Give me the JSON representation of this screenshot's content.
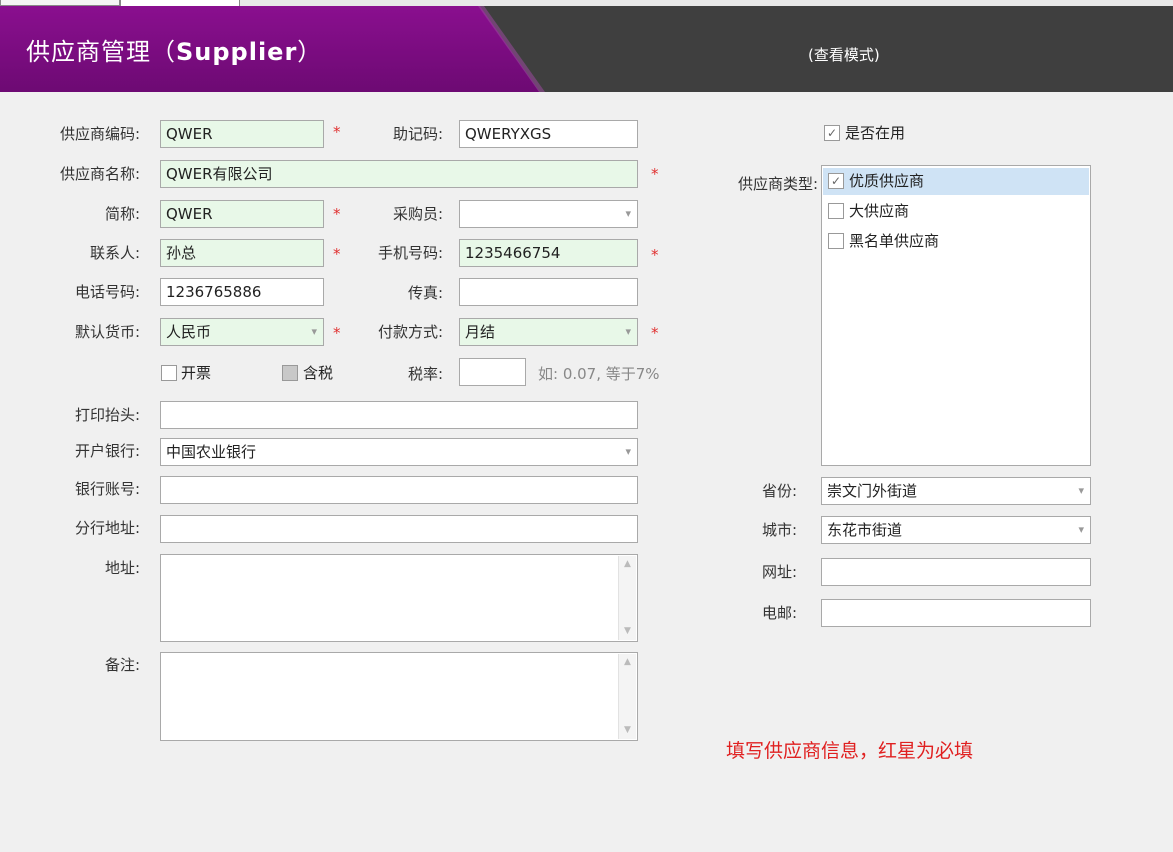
{
  "header": {
    "title_cn": "供应商管理（",
    "title_en": "Supplier",
    "title_close": "）",
    "mode": "(查看模式)"
  },
  "form": {
    "code": {
      "label": "供应商编码:",
      "value": "QWER"
    },
    "mnemonic": {
      "label": "助记码:",
      "value": "QWERYXGS"
    },
    "name": {
      "label": "供应商名称:",
      "value": "QWER有限公司"
    },
    "short": {
      "label": "简称:",
      "value": "QWER"
    },
    "buyer": {
      "label": "采购员:",
      "value": ""
    },
    "contact": {
      "label": "联系人:",
      "value": "孙总"
    },
    "mobile": {
      "label": "手机号码:",
      "value": "1235466754"
    },
    "phone": {
      "label": "电话号码:",
      "value": "1236765886"
    },
    "fax": {
      "label": "传真:",
      "value": ""
    },
    "currency": {
      "label": "默认货币:",
      "value": "人民币"
    },
    "payment": {
      "label": "付款方式:",
      "value": "月结"
    },
    "invoice": {
      "label": "开票",
      "checked": false
    },
    "tax_incl": {
      "label": "含税",
      "checked": false
    },
    "tax_rate": {
      "label": "税率:",
      "value": "",
      "hint": "如: 0.07, 等于7%"
    },
    "print_header": {
      "label": "打印抬头:",
      "value": ""
    },
    "bank": {
      "label": "开户银行:",
      "value": "中国农业银行"
    },
    "account": {
      "label": "银行账号:",
      "value": ""
    },
    "branch": {
      "label": "分行地址:",
      "value": ""
    },
    "address": {
      "label": "地址:",
      "value": ""
    },
    "remark": {
      "label": "备注:",
      "value": ""
    },
    "required_star": "*"
  },
  "right": {
    "in_use": {
      "label": "是否在用",
      "checked": true
    },
    "type_label": "供应商类型:",
    "types": [
      {
        "label": "优质供应商",
        "checked": true
      },
      {
        "label": "大供应商",
        "checked": false
      },
      {
        "label": "黑名单供应商",
        "checked": false
      }
    ],
    "province": {
      "label": "省份:",
      "value": "崇文门外街道"
    },
    "city": {
      "label": "城市:",
      "value": "东花市街道"
    },
    "website": {
      "label": "网址:",
      "value": ""
    },
    "email": {
      "label": "电邮:",
      "value": ""
    }
  },
  "note": "填写供应商信息，红星为必填",
  "colors": {
    "header_purple": "#7a0c80",
    "header_dark": "#3f3f3f",
    "required_bg": "#e8f8e8",
    "star": "#e03030",
    "note": "#e02020"
  },
  "icons": {
    "dropdown": "▾",
    "check": "✓",
    "scroll_up": "▲",
    "scroll_down": "▼"
  }
}
